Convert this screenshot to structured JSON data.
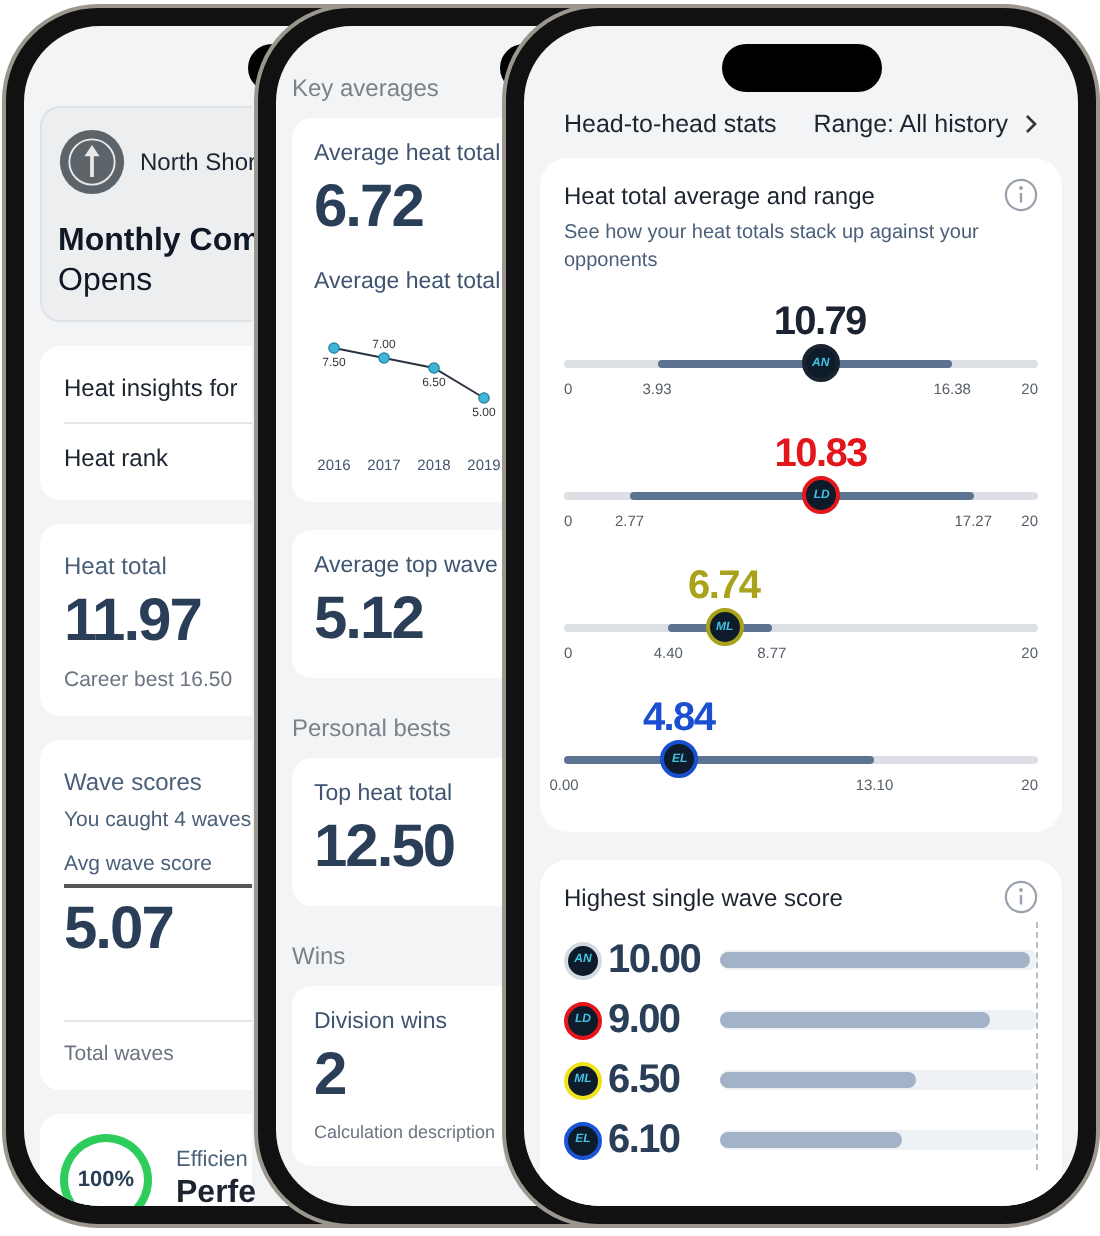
{
  "event_screen": {
    "club": "North Shor",
    "title": "Monthly Com",
    "subtitle": "Opens",
    "insights": [
      "Heat insights for",
      "Heat rank"
    ],
    "heat_total": {
      "label": "Heat total",
      "value": "11.97",
      "note": "Career best 16.50"
    },
    "wave_scores": {
      "title": "Wave scores",
      "summary": "You caught 4 waves",
      "avg_label": "Avg wave score",
      "avg_value": "5.07",
      "total_label": "Total waves"
    },
    "efficiency": {
      "ring_label": "100%",
      "level": 1,
      "title": "Efficien",
      "value": "Perfe"
    }
  },
  "career_screen": {
    "sections": [
      {
        "title": "Key averages",
        "cards": [
          {
            "label": "Average heat total",
            "value": "6.72",
            "chart_label": "Average heat total",
            "chart_data": {
              "type": "line",
              "categories": [
                "2016",
                "2017",
                "2018",
                "2019"
              ],
              "values": [
                7.5,
                7.0,
                6.5,
                5.0
              ],
              "value_labels": [
                "7.50",
                "7.00",
                "6.50",
                "5.00"
              ],
              "marker": true
            }
          },
          {
            "label": "Average top wave",
            "value": "5.12"
          }
        ]
      },
      {
        "title": "Personal bests",
        "cards": [
          {
            "label": "Top heat total",
            "value": "12.50"
          }
        ]
      },
      {
        "title": "Wins",
        "cards": [
          {
            "label": "Division wins",
            "value": "2",
            "note": "Calculation description"
          }
        ]
      }
    ]
  },
  "head_to_head_screen": {
    "title": "Head-to-head stats",
    "range": "Range: All history",
    "range_card": {
      "title": "Heat total average and range",
      "subtitle": "See how your heat totals stack up against your opponents",
      "rows": [
        {
          "initials": "AN",
          "value": "10.79",
          "min": "0",
          "low": "3.93",
          "high": "16.38",
          "max": "20",
          "color": "#1b2330"
        },
        {
          "initials": "LD",
          "value": "10.83",
          "min": "0",
          "low": "2.77",
          "high": "17.27",
          "max": "20",
          "color": "#e3161c"
        },
        {
          "initials": "ML",
          "value": "6.74",
          "min": "0",
          "low": "4.40",
          "high": "8.77",
          "max": "20",
          "color": "#a9a31b"
        },
        {
          "initials": "EL",
          "value": "4.84",
          "low": "0.00",
          "high": "13.10",
          "max": "20",
          "color": "#1a4fd0"
        }
      ]
    },
    "best_wave_card": {
      "title": "Highest single wave score",
      "rows": [
        {
          "initials": "AN",
          "value": "10.00",
          "level": 1,
          "color": "#d5dae1"
        },
        {
          "initials": "LD",
          "value": "9.00",
          "level": 0.87,
          "color": "#e3161c"
        },
        {
          "initials": "ML",
          "value": "6.50",
          "level": 0.63,
          "color": "#f0e21c"
        },
        {
          "initials": "EL",
          "value": "6.10",
          "level": 0.59,
          "color": "#1a55d6"
        }
      ]
    }
  }
}
